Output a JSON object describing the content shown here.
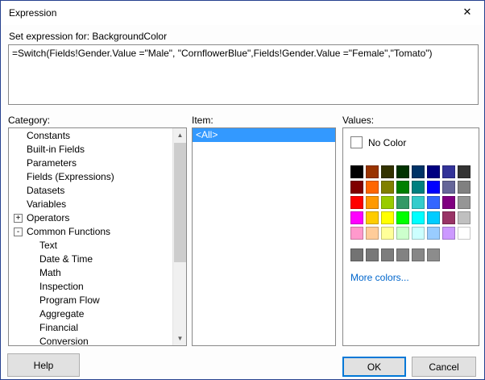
{
  "window": {
    "title": "Expression",
    "close_glyph": "✕"
  },
  "expression": {
    "label": "Set expression for: BackgroundColor",
    "value": "=Switch(Fields!Gender.Value =\"Male\", \"CornflowerBlue\",Fields!Gender.Value =\"Female\",\"Tomato\")"
  },
  "category": {
    "label": "Category:",
    "items": [
      {
        "label": "Constants",
        "indent": 0,
        "expander": ""
      },
      {
        "label": "Built-in Fields",
        "indent": 0,
        "expander": ""
      },
      {
        "label": "Parameters",
        "indent": 0,
        "expander": ""
      },
      {
        "label": "Fields (Expressions)",
        "indent": 0,
        "expander": ""
      },
      {
        "label": "Datasets",
        "indent": 0,
        "expander": ""
      },
      {
        "label": "Variables",
        "indent": 0,
        "expander": ""
      },
      {
        "label": "Operators",
        "indent": 0,
        "expander": "+"
      },
      {
        "label": "Common Functions",
        "indent": 0,
        "expander": "-"
      },
      {
        "label": "Text",
        "indent": 1,
        "expander": ""
      },
      {
        "label": "Date & Time",
        "indent": 1,
        "expander": ""
      },
      {
        "label": "Math",
        "indent": 1,
        "expander": ""
      },
      {
        "label": "Inspection",
        "indent": 1,
        "expander": ""
      },
      {
        "label": "Program Flow",
        "indent": 1,
        "expander": ""
      },
      {
        "label": "Aggregate",
        "indent": 1,
        "expander": ""
      },
      {
        "label": "Financial",
        "indent": 1,
        "expander": ""
      },
      {
        "label": "Conversion",
        "indent": 1,
        "expander": ""
      }
    ]
  },
  "item": {
    "label": "Item:",
    "items": [
      {
        "label": "<All>",
        "selected": true
      }
    ]
  },
  "values": {
    "label": "Values:",
    "no_color_label": "No Color",
    "more_colors_label": "More colors...",
    "palette": [
      [
        "#000000",
        "#993300",
        "#333300",
        "#003300",
        "#003366",
        "#000080",
        "#333399",
        "#333333"
      ],
      [
        "#800000",
        "#FF6600",
        "#808000",
        "#008000",
        "#008080",
        "#0000FF",
        "#666699",
        "#808080"
      ],
      [
        "#FF0000",
        "#FF9900",
        "#99CC00",
        "#339966",
        "#33CCCC",
        "#3366FF",
        "#800080",
        "#969696"
      ],
      [
        "#FF00FF",
        "#FFCC00",
        "#FFFF00",
        "#00FF00",
        "#00FFFF",
        "#00CCFF",
        "#993366",
        "#C0C0C0"
      ],
      [
        "#FF99CC",
        "#FFCC99",
        "#FFFF99",
        "#CCFFCC",
        "#CCFFFF",
        "#99CCFF",
        "#CC99FF",
        "#FFFFFF"
      ]
    ],
    "grays": [
      "#737373",
      "#787878",
      "#7D7D7D",
      "#828282",
      "#878787",
      "#8C8C8C"
    ]
  },
  "buttons": {
    "help": "Help",
    "ok": "OK",
    "cancel": "Cancel"
  },
  "colors": {
    "accent": "#0078d7",
    "selection": "#3399ff",
    "link": "#0066cc",
    "window_border": "#26418f"
  }
}
